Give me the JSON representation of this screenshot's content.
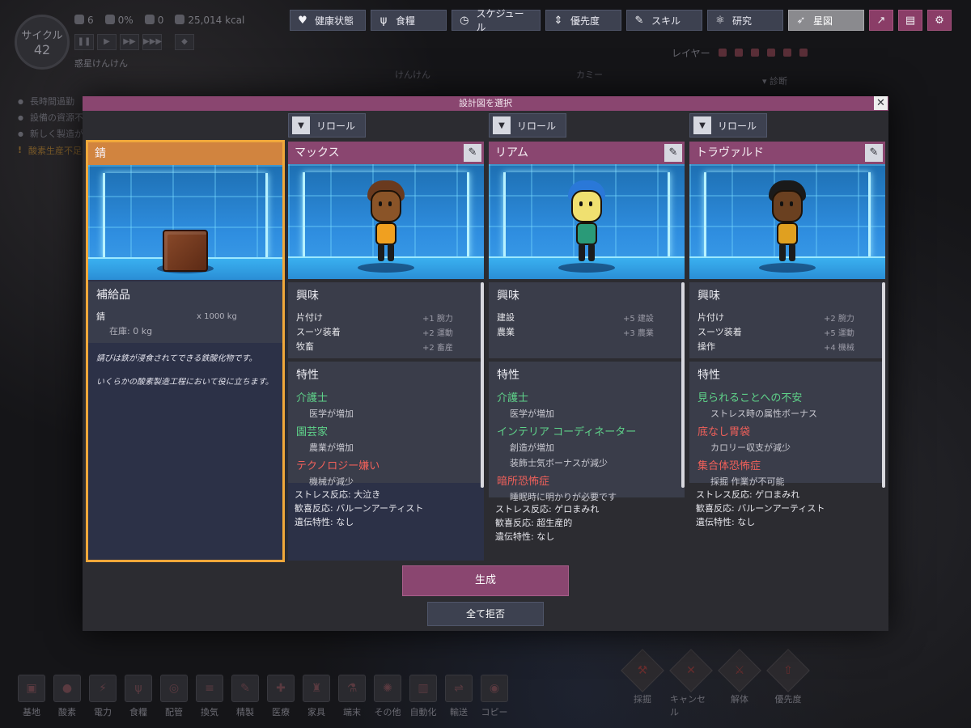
{
  "hud": {
    "cycle_label": "サイクル",
    "cycle_number": "42",
    "duplicants": "6",
    "stress": "0%",
    "sick": "0",
    "calories": "25,014 kcal",
    "colony_name": "惑星けんけん",
    "alerts": [
      {
        "text": "長時間過勤",
        "color": "#5e5e66"
      },
      {
        "text": "設備の資源不",
        "color": "#5e5e66"
      },
      {
        "text": "新しく製造が",
        "color": "#5e5e66"
      },
      {
        "text": "酸素生産不足",
        "color": "#7a5a28"
      }
    ]
  },
  "topbar": {
    "health": "健康状態",
    "food": "食糧",
    "schedule": "スケジュール",
    "priority": "優先度",
    "skills": "スキル",
    "research": "研究",
    "starmap": "星図"
  },
  "overlay": {
    "layers_label": "レイヤー",
    "diagnostics_label": "診断",
    "world_label_1": "けんけん",
    "world_label_2": "カミー"
  },
  "bottombar": {
    "items": [
      "基地",
      "酸素",
      "電力",
      "食糧",
      "配管",
      "換気",
      "精製",
      "医療",
      "家具",
      "端末",
      "その他",
      "自動化",
      "輸送",
      "コピー"
    ],
    "tools": [
      "採掘",
      "キャンセル",
      "解体",
      "優先度"
    ]
  },
  "modal": {
    "title": "設計図を選択",
    "close_glyph": "✕",
    "reroll_label": "リロール",
    "generate_label": "生成",
    "reject_all_label": "全て拒否",
    "interests_heading": "興味",
    "traits_heading": "特性",
    "edit_glyph": "✎",
    "dropdown_glyph": "▼"
  },
  "supply_card": {
    "title": "錆",
    "section_heading": "補給品",
    "item_name": "錆",
    "item_amount": "x 1000 kg",
    "stock": "在庫: 0 kg",
    "desc_1": "錆びは鉄が浸食されてできる鉄酸化物です。",
    "desc_2": "いくらかの酸素製造工程において役に立ちます。"
  },
  "dupes": [
    {
      "name": "マックス",
      "hair_color": "#6a3a1e",
      "skin_color": "#8a5428",
      "shirt_color": "#f0a020",
      "interests": [
        {
          "name": "片付け",
          "value": "+1 腕力"
        },
        {
          "name": "スーツ装着",
          "value": "+2 運動"
        },
        {
          "name": "牧畜",
          "value": "+2 畜産"
        }
      ],
      "traits": [
        {
          "name": "介護士",
          "kind": "pos",
          "desc": [
            "医学が増加"
          ]
        },
        {
          "name": "園芸家",
          "kind": "pos",
          "desc": [
            "農業が増加"
          ]
        },
        {
          "name": "テクノロジー嫌い",
          "kind": "neg",
          "desc": [
            "機械が減少"
          ]
        }
      ],
      "stress": "ストレス反応: 大泣き",
      "joy": "歓喜反応: バルーンアーティスト",
      "genetic": "遺伝特性: なし"
    },
    {
      "name": "リアム",
      "hair_color": "#2a78d8",
      "skin_color": "#f0e070",
      "shirt_color": "#2a9a78",
      "interests": [
        {
          "name": "建設",
          "value": "+5 建設"
        },
        {
          "name": "農業",
          "value": "+3 農業"
        }
      ],
      "traits": [
        {
          "name": "介護士",
          "kind": "pos",
          "desc": [
            "医学が増加"
          ]
        },
        {
          "name": "インテリア コーディネーター",
          "kind": "pos",
          "desc": [
            "創造が増加",
            "装飾士気ボーナスが減少"
          ]
        },
        {
          "name": "暗所恐怖症",
          "kind": "neg",
          "desc": [
            "睡眠時に明かりが必要です"
          ]
        }
      ],
      "stress": "ストレス反応: ゲロまみれ",
      "joy": "歓喜反応: 超生産的",
      "genetic": "遺伝特性: なし"
    },
    {
      "name": "トラヴァルド",
      "hair_color": "#1a1a1a",
      "skin_color": "#6a4020",
      "shirt_color": "#e0a020",
      "interests": [
        {
          "name": "片付け",
          "value": "+2 腕力"
        },
        {
          "name": "スーツ装着",
          "value": "+5 運動"
        },
        {
          "name": "操作",
          "value": "+4 機械"
        }
      ],
      "traits": [
        {
          "name": "見られることへの不安",
          "kind": "pos",
          "desc": [
            "ストレス時の属性ボーナス"
          ]
        },
        {
          "name": "底なし胃袋",
          "kind": "neg",
          "desc": [
            "カロリー収支が減少"
          ]
        },
        {
          "name": "集合体恐怖症",
          "kind": "neg",
          "desc": [
            "採掘 作業が不可能"
          ]
        }
      ],
      "stress": "ストレス反応: ゲロまみれ",
      "joy": "歓喜反応: バルーンアーティスト",
      "genetic": "遺伝特性: なし"
    }
  ]
}
